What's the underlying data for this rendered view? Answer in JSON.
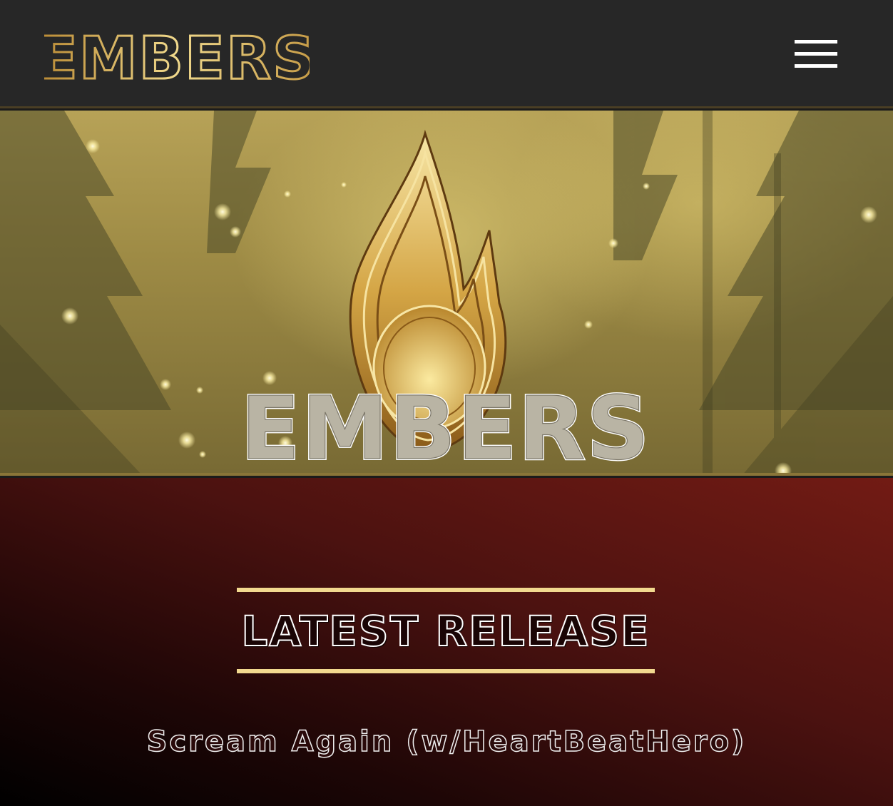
{
  "header": {
    "brand": "EMBERS",
    "menu_icon": "hamburger-menu-icon"
  },
  "hero": {
    "title": "EMBERS",
    "emblem_icon": "flame-drop-icon"
  },
  "release": {
    "heading": "LATEST RELEASE",
    "track_title": "Scream Again (w/HeartBeatHero)"
  },
  "colors": {
    "header_bg": "#272727",
    "gold": "#d9b258",
    "rule": "#f2d98f",
    "release_gradient_start": "#721b14",
    "release_gradient_end": "#000000"
  }
}
